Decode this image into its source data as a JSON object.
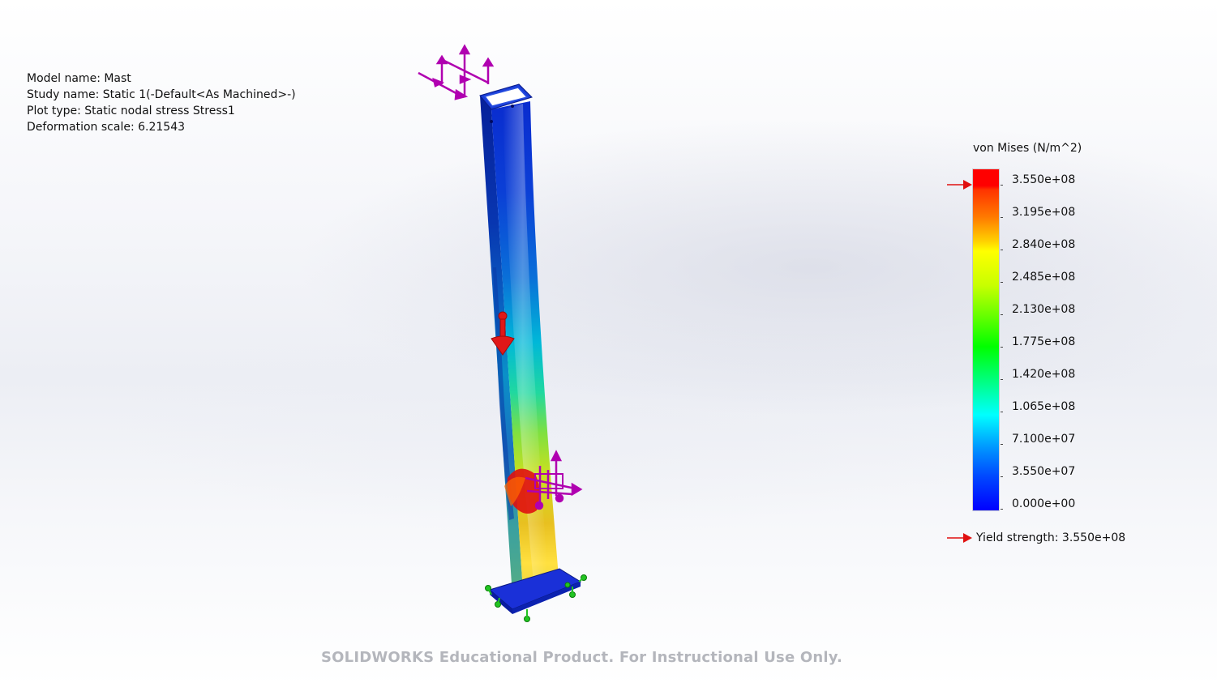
{
  "info": {
    "model_name": "Model name: Mast",
    "study_name": "Study name: Static 1(-Default<As Machined>-)",
    "plot_type": "Plot type: Static nodal stress Stress1",
    "deformation_scale": "Deformation scale: 6.21543"
  },
  "legend": {
    "title": "von Mises (N/m^2)",
    "ticks": [
      "3.550e+08",
      "3.195e+08",
      "2.840e+08",
      "2.485e+08",
      "2.130e+08",
      "1.775e+08",
      "1.420e+08",
      "1.065e+08",
      "7.100e+07",
      "3.550e+07",
      "0.000e+00"
    ],
    "yield_label": "Yield strength: 3.550e+08",
    "max_color": "#ff0000",
    "min_color": "#0000ff"
  },
  "watermark": "SOLIDWORKS Educational Product. For Instructional Use Only.",
  "colors": {
    "fixture": "#22c422",
    "external_load": "#b000b0",
    "point_load": "#e01818",
    "yield_arrow": "#e01010"
  }
}
